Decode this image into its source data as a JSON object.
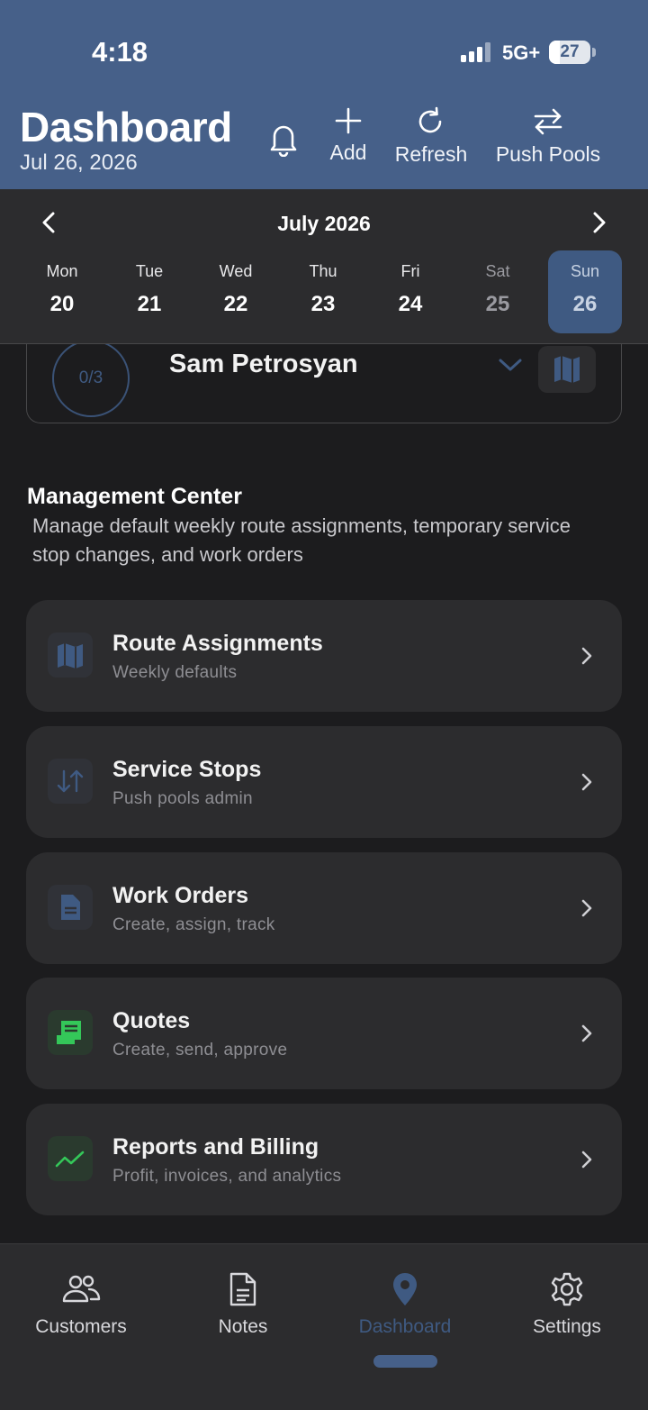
{
  "status_bar": {
    "time": "4:18",
    "network": "5G+",
    "battery": "27",
    "battery_level": 0.27
  },
  "header": {
    "title": "Dashboard",
    "date": "Jul 26, 2026",
    "actions": [
      {
        "label": "Add",
        "icon": "plus-icon"
      },
      {
        "label": "Refresh",
        "icon": "refresh-icon"
      },
      {
        "label": "Push Pools",
        "icon": "swap-icon"
      }
    ]
  },
  "calendar": {
    "month": "July 2026",
    "days": [
      {
        "name": "Mon",
        "num": "20"
      },
      {
        "name": "Tue",
        "num": "21"
      },
      {
        "name": "Wed",
        "num": "22"
      },
      {
        "name": "Thu",
        "num": "23"
      },
      {
        "name": "Fri",
        "num": "24"
      },
      {
        "name": "Sat",
        "num": "25"
      },
      {
        "name": "Sun",
        "num": "26"
      }
    ],
    "selected_day": "Sun"
  },
  "technician": {
    "progress": "0/3",
    "name": "Sam Petrosyan"
  },
  "management": {
    "title": "Management Center",
    "description": "Manage default weekly route assignments, temporary service stop changes, and work orders",
    "items": [
      {
        "title": "Route Assignments",
        "subtitle": "Weekly defaults",
        "icon": "map-icon",
        "color": "#3f5a82"
      },
      {
        "title": "Service Stops",
        "subtitle": "Push pools admin",
        "icon": "swap-vertical-icon",
        "color": "#3f5a82"
      },
      {
        "title": "Work Orders",
        "subtitle": "Create, assign, track",
        "icon": "document-icon",
        "color": "#3f5a82"
      },
      {
        "title": "Quotes",
        "subtitle": "Create, send, approve",
        "icon": "receipt-icon",
        "color": "#34c759"
      },
      {
        "title": "Reports and Billing",
        "subtitle": "Profit, invoices, and analytics",
        "icon": "trend-icon",
        "color": "#34c759"
      }
    ]
  },
  "tabs": [
    {
      "label": "Customers",
      "icon": "people-icon"
    },
    {
      "label": "Notes",
      "icon": "notes-icon"
    },
    {
      "label": "Dashboard",
      "icon": "location-pin-icon"
    },
    {
      "label": "Settings",
      "icon": "gear-icon"
    }
  ],
  "active_tab": "Dashboard"
}
